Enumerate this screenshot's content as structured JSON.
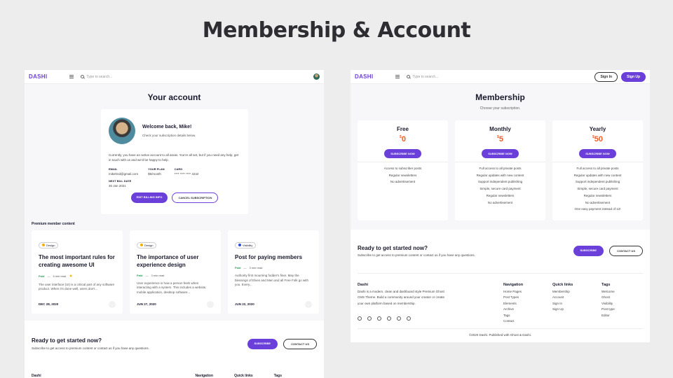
{
  "page_title": "Membership & Account",
  "brand": {
    "logo": "DASHI",
    "accent": "#6b3fd9",
    "price_color": "#f05b23"
  },
  "search_placeholder": "Type to search...",
  "account": {
    "title": "Your account",
    "welcome": "Welcome back, Mike!",
    "check": "Check your subscription details below.",
    "message": "Currently, you have an active account to all areas. You're all set, but if you need any help, get in touch with us and we'd be happy to help.",
    "fields": [
      {
        "label": "EMAIL",
        "value": "mikehnd@gmail.com"
      },
      {
        "label": "YOUR PLAN",
        "value": "$5/month"
      },
      {
        "label": "CARD",
        "value": "**** **** **** 4242"
      }
    ],
    "next_bill_label": "NEXT BILL DATE",
    "next_bill_value": "30 Jan 2021",
    "edit_billing": "EDIT BILLING INFO",
    "cancel": "CANCEL SUBSCRIPTION"
  },
  "premium_label": "Premium member content",
  "posts": [
    {
      "tag": "Design",
      "tag_color": "#f2b100",
      "title": "The most important rules for creating awesome UI",
      "status": "Paid",
      "read": "5 min read",
      "excerpt": "The user interface (UI) is a critical part of any software product. When it's done well, users don't...",
      "date": "DEC 28, 2020"
    },
    {
      "tag": "Design",
      "tag_color": "#f2b100",
      "title": "The importance of user experience design",
      "status": "Paid",
      "read": "3 min read",
      "excerpt": "User experience is how a person feels when interacting with a system. This includes a website, mobile application, desktop software...",
      "date": "JUN 27, 2020"
    },
    {
      "tag": "Visibility",
      "tag_color": "#2a4fd9",
      "title": "Post for paying members",
      "status": "Paid",
      "read": "3 min read",
      "excerpt": "Authority first mourning fodder's finer. May the blessings of Elves and Men and all Free Folk go with you. Every...",
      "date": "JUN 22, 2020"
    }
  ],
  "cta": {
    "title": "Ready to get started now?",
    "subtitle": "Subscribe to get access to premium content or contact us if you have any questions.",
    "subscribe": "SUBSCRIBE",
    "contact": "CONTACT US"
  },
  "left_footer_heads": [
    "Dashi",
    "Navigation",
    "Quick links",
    "Tags"
  ],
  "membership": {
    "title": "Membership",
    "subtitle": "Choose your subscription.",
    "sign_in": "Sign In",
    "sign_up": "Sign Up",
    "plans": [
      {
        "name": "Free",
        "currency": "$",
        "price": "0",
        "button": "SUBSCRIBE NOW",
        "features": [
          "Access to subscriber posts",
          "Regular newsletters",
          "No advertisement"
        ]
      },
      {
        "name": "Monthly",
        "currency": "$",
        "price": "5",
        "button": "SUBSCRIBE NOW",
        "features": [
          "Full access to all private posts",
          "Regular updates with new content",
          "Support independent publishing",
          "Simple, secure card payment",
          "Regular newsletters",
          "No advertisement"
        ]
      },
      {
        "name": "Yearly",
        "currency": "$",
        "price": "50",
        "button": "SUBSCRIBE NOW",
        "features": [
          "Full access to all private posts",
          "Regular updates with new content",
          "Support independent publishing",
          "Simple, secure card payment",
          "Regular newsletters",
          "No advertisement",
          "One easy payment instead of 12!"
        ]
      }
    ]
  },
  "footer": {
    "brand": "Dashi",
    "about": "Dashi is a modern, clean and dashboard style Premium Ghost CMS Theme. Build a community around your creator or create your own platform based on membership.",
    "nav_title": "Navigation",
    "nav": [
      "Home Pages",
      "Post Types",
      "Elements",
      "Archive",
      "Tags",
      "Contact"
    ],
    "quick_title": "Quick links",
    "quick": [
      "Membership",
      "Account",
      "Sign In",
      "Sign Up"
    ],
    "tags_title": "Tags",
    "tags": [
      "Welcome",
      "Ghost",
      "Visibility",
      "Post type",
      "Editor"
    ],
    "copyright": "©2020 Dashi. Published with Ghost & Dashi."
  }
}
